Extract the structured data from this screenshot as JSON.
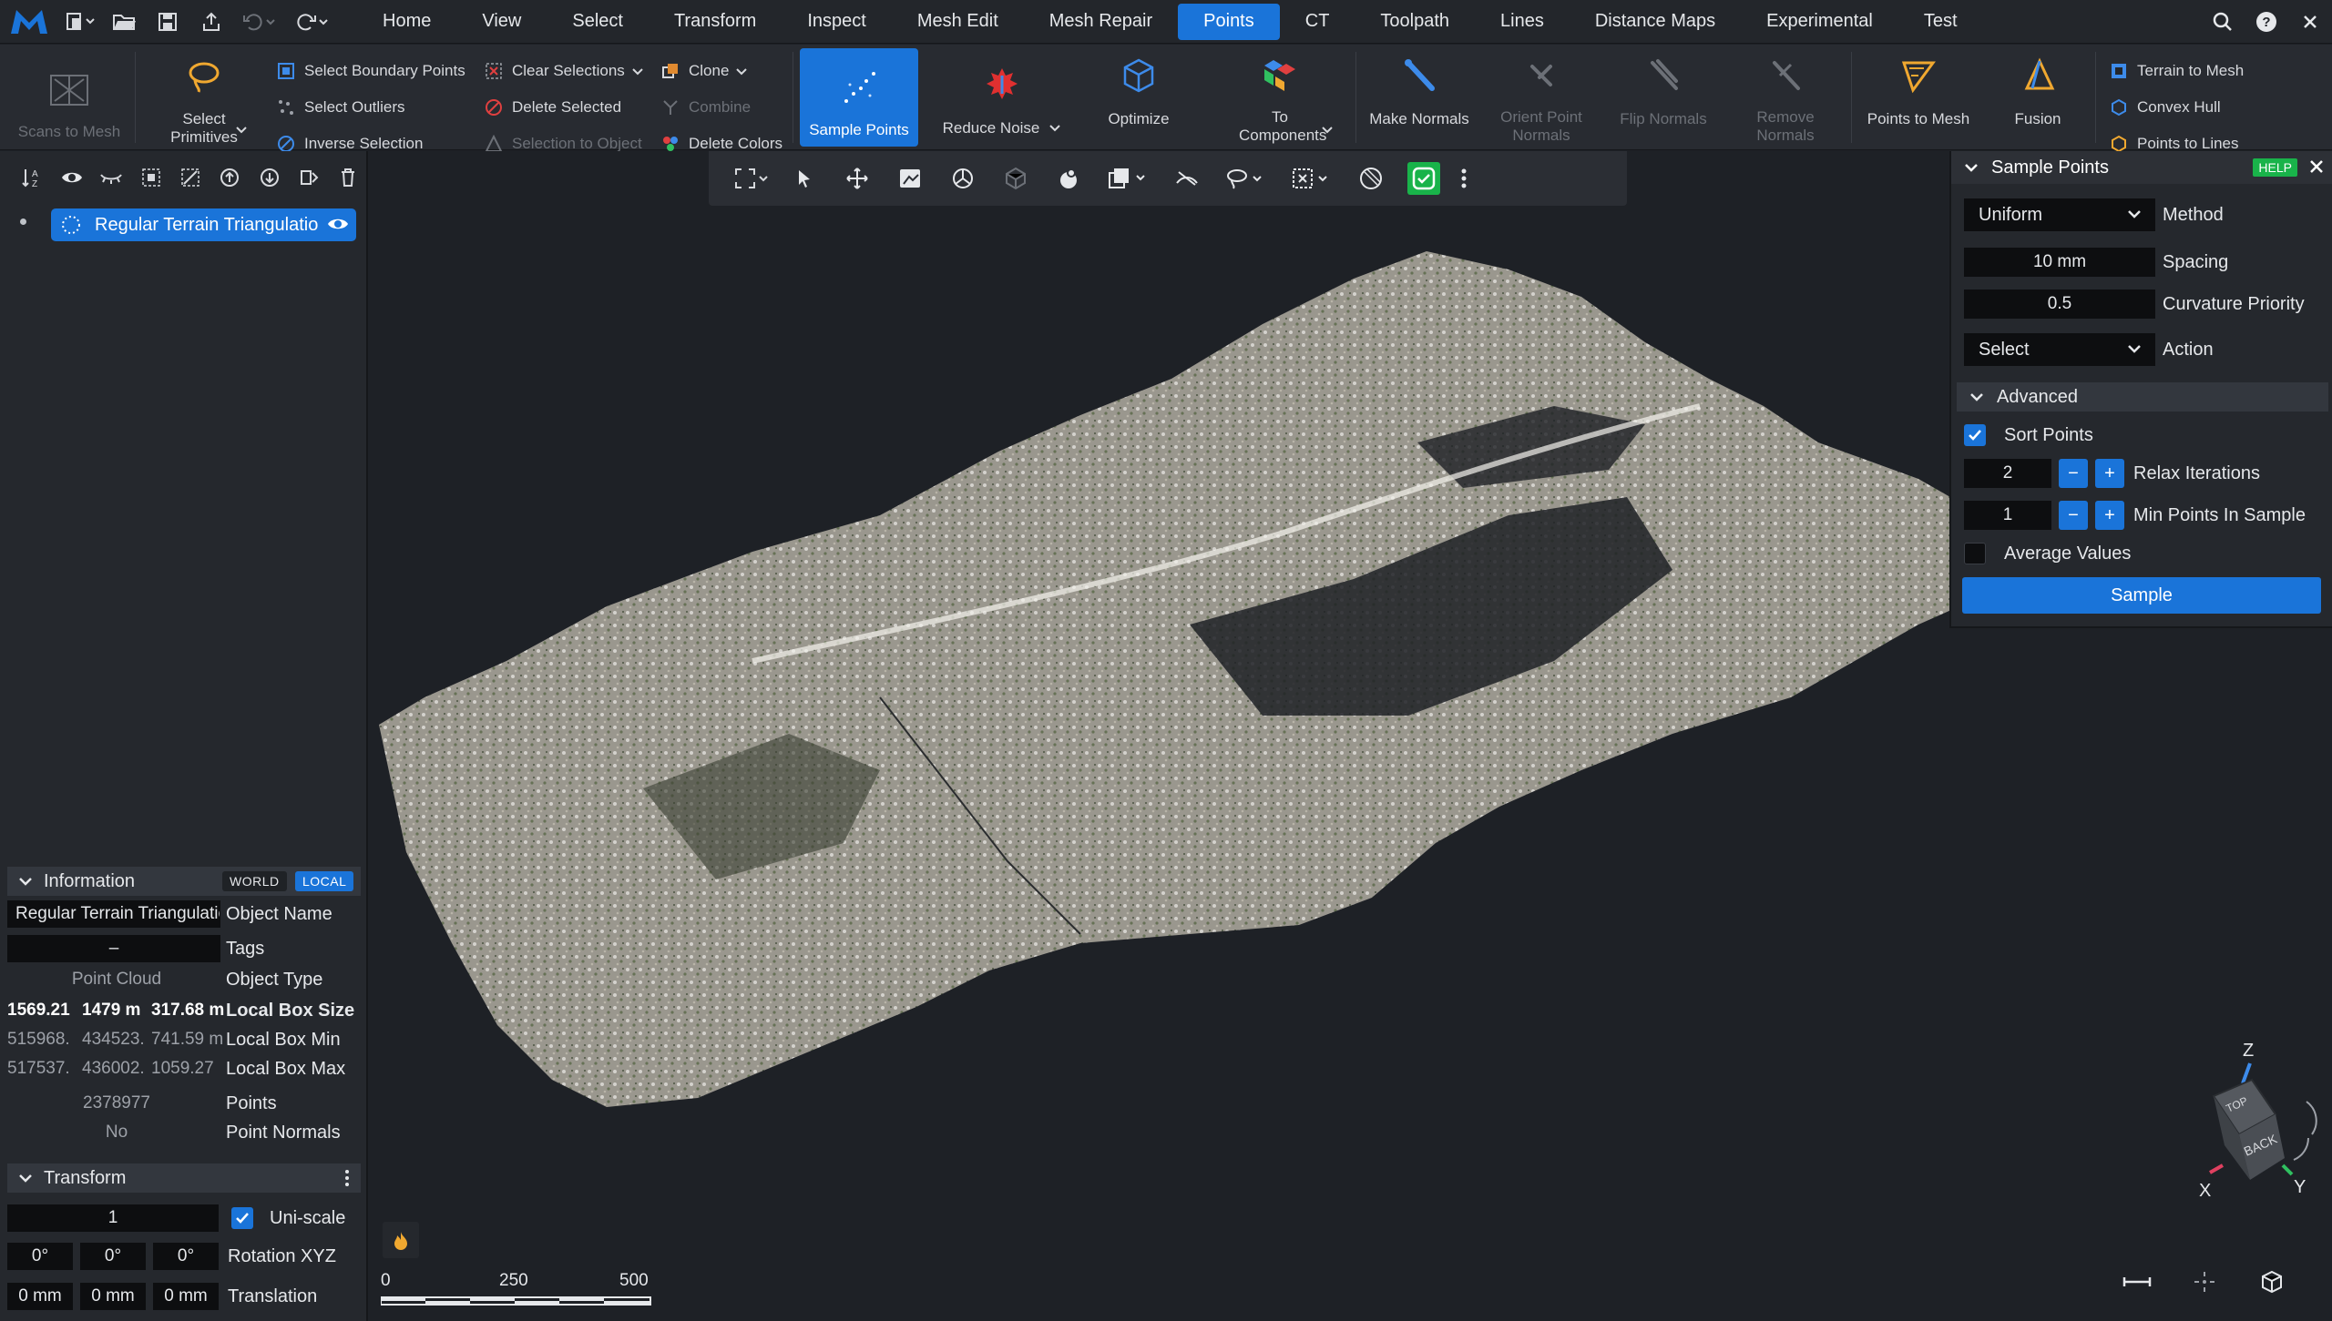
{
  "menubar": {
    "items": [
      "Home",
      "View",
      "Select",
      "Transform",
      "Inspect",
      "Mesh Edit",
      "Mesh Repair",
      "Points",
      "CT",
      "Toolpath",
      "Lines",
      "Distance Maps",
      "Experimental",
      "Test"
    ],
    "active": "Points"
  },
  "ribbon": {
    "scans_to_mesh": "Scans to Mesh",
    "select_primitives": "Select Primitives",
    "select_boundary_points": "Select Boundary Points",
    "select_outliers": "Select Outliers",
    "inverse_selection": "Inverse Selection",
    "clear_selections": "Clear Selections",
    "delete_selected": "Delete Selected",
    "selection_to_object": "Selection to Object",
    "clone": "Clone",
    "combine": "Combine",
    "delete_colors": "Delete Colors",
    "sample_points": "Sample Points",
    "reduce_noise": "Reduce Noise",
    "optimize": "Optimize",
    "to_components": "To Components",
    "make_normals": "Make Normals",
    "orient_point_normals": "Orient Point Normals",
    "flip_normals": "Flip Normals",
    "remove_normals": "Remove Normals",
    "points_to_mesh": "Points to Mesh",
    "fusion": "Fusion",
    "terrain_to_mesh": "Terrain to Mesh",
    "convex_hull": "Convex Hull",
    "points_to_lines": "Points to Lines"
  },
  "tree": {
    "item_label": "Regular Terrain Triangulation"
  },
  "information": {
    "title": "Information",
    "world": "WORLD",
    "local": "LOCAL",
    "object_name_value": "Regular Terrain Triangulation",
    "object_name_label": "Object Name",
    "tags_value": "–",
    "tags_label": "Tags",
    "object_type_value": "Point Cloud",
    "object_type_label": "Object Type",
    "box_size": [
      "1569.21",
      "1479 m",
      "317.68 m"
    ],
    "box_size_label": "Local Box Size",
    "box_min": [
      "515968.",
      "434523.",
      "741.59 m"
    ],
    "box_min_label": "Local Box Min",
    "box_max": [
      "517537.",
      "436002.",
      "1059.27"
    ],
    "box_max_label": "Local Box Max",
    "points_value": "2378977",
    "points_label": "Points",
    "normals_value": "No",
    "normals_label": "Point Normals"
  },
  "transform": {
    "title": "Transform",
    "scale_value": "1",
    "uniscale_label": "Uni-scale",
    "rotation": [
      "0°",
      "0°",
      "0°"
    ],
    "rotation_label": "Rotation XYZ",
    "translation": [
      "0 mm",
      "0 mm",
      "0 mm"
    ],
    "translation_label": "Translation"
  },
  "scalebar": {
    "ticks": [
      "0",
      "250",
      "500"
    ]
  },
  "gizmo": {
    "z": "Z",
    "x": "X",
    "y": "Y",
    "top": "TOP",
    "back": "BACK"
  },
  "sample_panel": {
    "title": "Sample Points",
    "help": "HELP",
    "method_value": "Uniform",
    "method_label": "Method",
    "spacing_value": "10 mm",
    "spacing_label": "Spacing",
    "curvature_value": "0.5",
    "curvature_label": "Curvature Priority",
    "action_value": "Select",
    "action_label": "Action",
    "advanced_title": "Advanced",
    "sort_points_label": "Sort Points",
    "sort_points_checked": true,
    "relax_value": "2",
    "relax_label": "Relax Iterations",
    "min_points_value": "1",
    "min_points_label": "Min Points In Sample",
    "average_values_label": "Average Values",
    "average_values_checked": false,
    "sample_button": "Sample"
  },
  "colors": {
    "accent": "#1a74d9",
    "help_green": "#19b34a",
    "ok_green": "#19b34a"
  }
}
